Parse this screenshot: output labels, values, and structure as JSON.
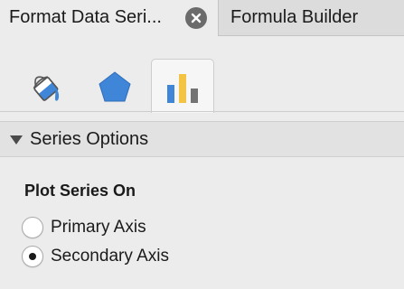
{
  "tabs": [
    {
      "label": "Format Data Seri...",
      "active": true
    },
    {
      "label": "Formula Builder",
      "active": false
    }
  ],
  "icon_tabs": [
    {
      "icon": "paint-bucket-icon",
      "selected": false
    },
    {
      "icon": "pentagon-icon",
      "selected": false
    },
    {
      "icon": "bar-chart-icon",
      "selected": true
    }
  ],
  "section": {
    "title": "Series Options",
    "expanded": true
  },
  "plot_series": {
    "title": "Plot Series On",
    "options": [
      {
        "label": "Primary Axis",
        "selected": false
      },
      {
        "label": "Secondary Axis",
        "selected": true
      }
    ]
  },
  "colors": {
    "accent_blue": "#3f86d9",
    "bar_yellow": "#f3c343",
    "bar_gray": "#737373"
  }
}
